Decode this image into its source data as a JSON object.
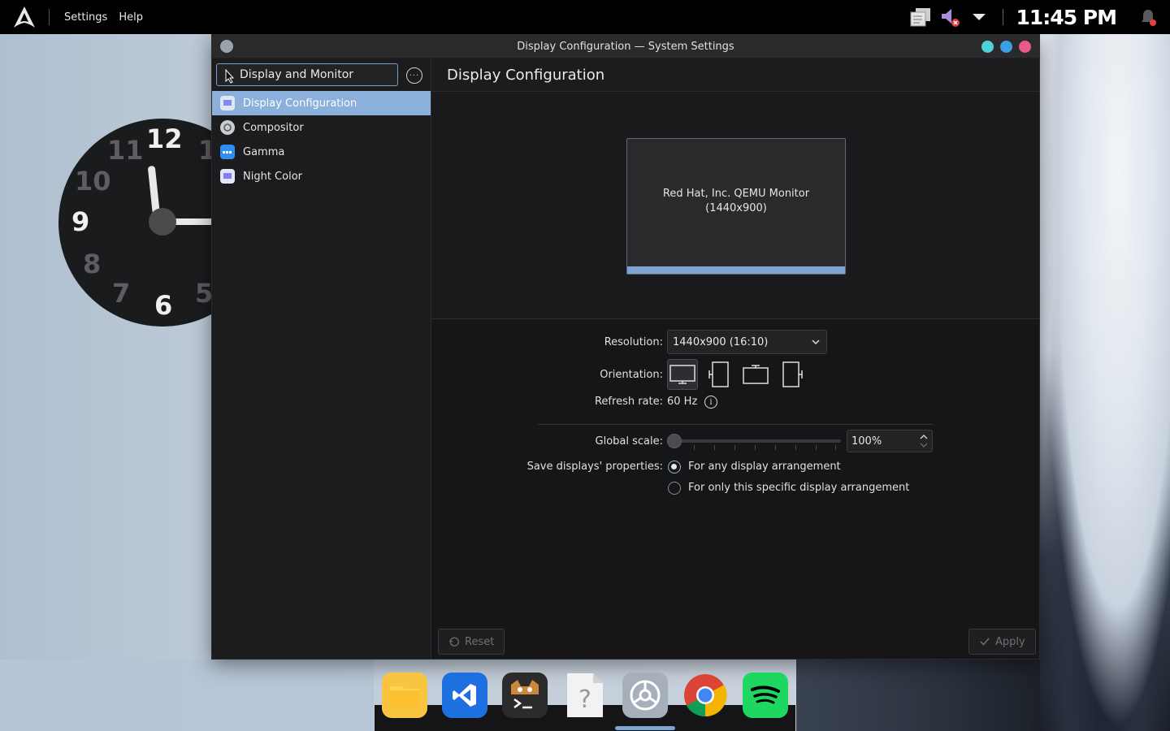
{
  "topbar": {
    "menu": [
      "Settings",
      "Help"
    ],
    "clock": "11:45 PM"
  },
  "desktop_clock": {
    "numerals": [
      "12",
      "11",
      "10",
      "9",
      "8",
      "7",
      "6",
      "5",
      "1"
    ]
  },
  "window": {
    "title": "Display Configuration — System Settings",
    "buttons": {
      "minimize_color": "#4fd1d9",
      "maximize_color": "#3aa0e8",
      "close_color": "#e85a8c"
    }
  },
  "sidebar": {
    "search_value": "Display and Monitor",
    "items": [
      {
        "label": "Display Configuration",
        "active": true,
        "icon": "display-icon"
      },
      {
        "label": "Compositor",
        "active": false,
        "icon": "compositor-icon"
      },
      {
        "label": "Gamma",
        "active": false,
        "icon": "gamma-icon"
      },
      {
        "label": "Night Color",
        "active": false,
        "icon": "night-color-icon"
      }
    ]
  },
  "content": {
    "title": "Display Configuration",
    "monitor": {
      "name": "Red Hat, Inc. QEMU Monitor",
      "resolution": "(1440x900)"
    },
    "resolution_label": "Resolution:",
    "resolution_value": "1440x900 (16:10)",
    "orientation_label": "Orientation:",
    "refresh_label": "Refresh rate:",
    "refresh_value": "60 Hz",
    "scale_label": "Global scale:",
    "scale_value": "100%",
    "save_label": "Save displays' properties:",
    "save_options": [
      "For any display arrangement",
      "For only this specific display arrangement"
    ],
    "save_selected": 0,
    "reset_label": "Reset",
    "apply_label": "Apply"
  },
  "accent": "#8ab0db"
}
